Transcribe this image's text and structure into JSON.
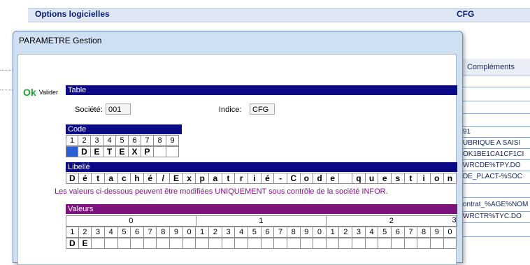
{
  "background": {
    "title": "Options logicielles",
    "code": "CFG",
    "tab_label": "Compléments",
    "right_items": [
      "91",
      "UBRIQUE A SAISI",
      "OK1BE1CA1CF1CI",
      "WRCDE%TPY.DO",
      "DE_PLACT-%SOC",
      "ontrat_%AGE%NOM",
      "WRCTR%TYC.DO"
    ]
  },
  "dialog": {
    "title": "PARAMETRE Gestion",
    "ok_icon": "Ok",
    "ok_label": "Valider",
    "table_band": "Table",
    "societe_label": "Société:",
    "societe_value": "001",
    "indice_label": "Indice:",
    "indice_value": "CFG",
    "code_band": "Code",
    "code_digits": [
      "1",
      "2",
      "3",
      "4",
      "5",
      "6",
      "7",
      "8",
      "9"
    ],
    "code_chars": [
      "",
      "D",
      "E",
      "T",
      "E",
      "X",
      "P",
      "",
      ""
    ],
    "libelle_band": "Libellé",
    "libelle_chars": [
      "D",
      "é",
      "t",
      "a",
      "c",
      "h",
      "é",
      "/",
      "E",
      "x",
      "p",
      "a",
      "t",
      "r",
      "i",
      "é",
      "-",
      "C",
      "o",
      "d",
      "e",
      "",
      "q",
      "u",
      "e",
      "s",
      "t",
      "i",
      "o",
      "n"
    ],
    "notice": "Les valeurs ci-dessous peuvent être modifiées UNIQUEMENT sous contrôle de la société INFOR.",
    "valeurs_band": "Valeurs",
    "tens": [
      "0",
      "1",
      "2",
      "3"
    ],
    "valeurs_digits": [
      "1",
      "2",
      "3",
      "4",
      "5",
      "6",
      "7",
      "8",
      "9",
      "0",
      "1",
      "2",
      "3",
      "4",
      "5",
      "6",
      "7",
      "8",
      "9",
      "0",
      "1",
      "2",
      "3",
      "4",
      "5",
      "6",
      "7",
      "8",
      "9",
      "0"
    ],
    "valeurs_chars": [
      "D",
      "E"
    ]
  },
  "colors": {
    "band": "#0a0a86",
    "valeurs_band": "#7d137d",
    "notice": "#8b0e8b",
    "ok": "#1fa12e"
  }
}
